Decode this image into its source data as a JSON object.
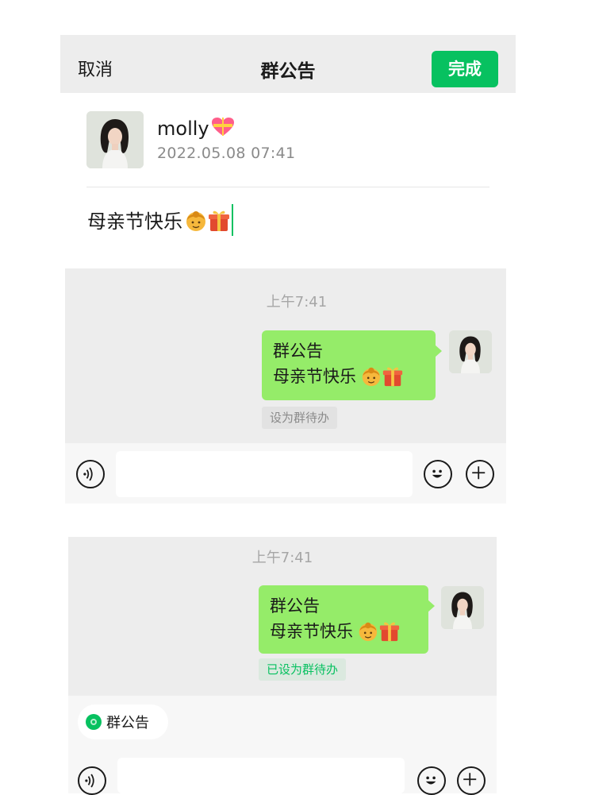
{
  "editor": {
    "cancel_label": "取消",
    "title": "群公告",
    "done_label": "完成",
    "author_name": "molly",
    "author_badge_icon": "heart-ribbon-emoji",
    "author_time": "2022.05.08  07:41",
    "content_text": "母亲节快乐",
    "content_emojis": [
      "mother-emoji",
      "gift-emoji"
    ]
  },
  "preview_before": {
    "time": "上午7:41",
    "bubble_title": "群公告",
    "bubble_body": "母亲节快乐",
    "todo_tag": "设为群待办"
  },
  "preview_after": {
    "time": "上午7:41",
    "bubble_title": "群公告",
    "bubble_body": "母亲节快乐",
    "todo_tag": "已设为群待办",
    "chip_label": "群公告"
  },
  "colors": {
    "accent_green": "#07c160",
    "bubble_green": "#95ec69",
    "panel_gray": "#ededed"
  },
  "icons": {
    "voice": "voice-icon",
    "emoji": "smiley-icon",
    "plus": "plus-icon"
  }
}
